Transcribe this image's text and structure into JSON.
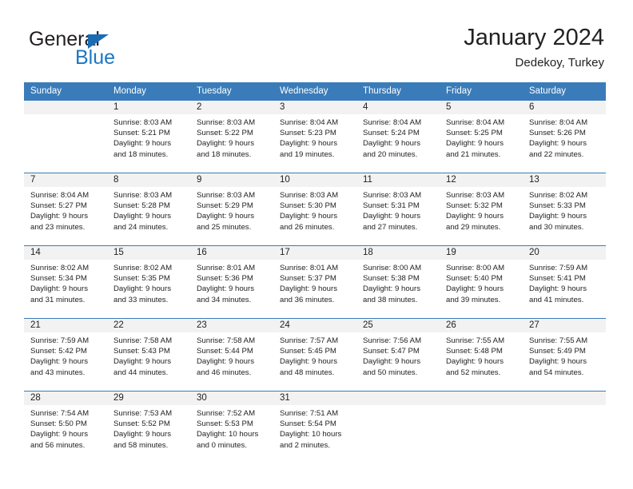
{
  "brand": {
    "name_part1": "General",
    "name_part2": "Blue",
    "triangle_color": "#1c6cb5",
    "blue_color": "#1c76c5"
  },
  "header": {
    "title": "January 2024",
    "subtitle": "Dedekoy, Turkey"
  },
  "theme": {
    "header_blue": "#3a7cb9",
    "daynum_band": "#f2f2f2",
    "text": "#222222"
  },
  "weekday_headers": [
    "Sunday",
    "Monday",
    "Tuesday",
    "Wednesday",
    "Thursday",
    "Friday",
    "Saturday"
  ],
  "weeks": [
    [
      {
        "day": "",
        "sunrise": "",
        "sunset": "",
        "daylight1": "",
        "daylight2": ""
      },
      {
        "day": "1",
        "sunrise": "Sunrise: 8:03 AM",
        "sunset": "Sunset: 5:21 PM",
        "daylight1": "Daylight: 9 hours",
        "daylight2": "and 18 minutes."
      },
      {
        "day": "2",
        "sunrise": "Sunrise: 8:03 AM",
        "sunset": "Sunset: 5:22 PM",
        "daylight1": "Daylight: 9 hours",
        "daylight2": "and 18 minutes."
      },
      {
        "day": "3",
        "sunrise": "Sunrise: 8:04 AM",
        "sunset": "Sunset: 5:23 PM",
        "daylight1": "Daylight: 9 hours",
        "daylight2": "and 19 minutes."
      },
      {
        "day": "4",
        "sunrise": "Sunrise: 8:04 AM",
        "sunset": "Sunset: 5:24 PM",
        "daylight1": "Daylight: 9 hours",
        "daylight2": "and 20 minutes."
      },
      {
        "day": "5",
        "sunrise": "Sunrise: 8:04 AM",
        "sunset": "Sunset: 5:25 PM",
        "daylight1": "Daylight: 9 hours",
        "daylight2": "and 21 minutes."
      },
      {
        "day": "6",
        "sunrise": "Sunrise: 8:04 AM",
        "sunset": "Sunset: 5:26 PM",
        "daylight1": "Daylight: 9 hours",
        "daylight2": "and 22 minutes."
      }
    ],
    [
      {
        "day": "7",
        "sunrise": "Sunrise: 8:04 AM",
        "sunset": "Sunset: 5:27 PM",
        "daylight1": "Daylight: 9 hours",
        "daylight2": "and 23 minutes."
      },
      {
        "day": "8",
        "sunrise": "Sunrise: 8:03 AM",
        "sunset": "Sunset: 5:28 PM",
        "daylight1": "Daylight: 9 hours",
        "daylight2": "and 24 minutes."
      },
      {
        "day": "9",
        "sunrise": "Sunrise: 8:03 AM",
        "sunset": "Sunset: 5:29 PM",
        "daylight1": "Daylight: 9 hours",
        "daylight2": "and 25 minutes."
      },
      {
        "day": "10",
        "sunrise": "Sunrise: 8:03 AM",
        "sunset": "Sunset: 5:30 PM",
        "daylight1": "Daylight: 9 hours",
        "daylight2": "and 26 minutes."
      },
      {
        "day": "11",
        "sunrise": "Sunrise: 8:03 AM",
        "sunset": "Sunset: 5:31 PM",
        "daylight1": "Daylight: 9 hours",
        "daylight2": "and 27 minutes."
      },
      {
        "day": "12",
        "sunrise": "Sunrise: 8:03 AM",
        "sunset": "Sunset: 5:32 PM",
        "daylight1": "Daylight: 9 hours",
        "daylight2": "and 29 minutes."
      },
      {
        "day": "13",
        "sunrise": "Sunrise: 8:02 AM",
        "sunset": "Sunset: 5:33 PM",
        "daylight1": "Daylight: 9 hours",
        "daylight2": "and 30 minutes."
      }
    ],
    [
      {
        "day": "14",
        "sunrise": "Sunrise: 8:02 AM",
        "sunset": "Sunset: 5:34 PM",
        "daylight1": "Daylight: 9 hours",
        "daylight2": "and 31 minutes."
      },
      {
        "day": "15",
        "sunrise": "Sunrise: 8:02 AM",
        "sunset": "Sunset: 5:35 PM",
        "daylight1": "Daylight: 9 hours",
        "daylight2": "and 33 minutes."
      },
      {
        "day": "16",
        "sunrise": "Sunrise: 8:01 AM",
        "sunset": "Sunset: 5:36 PM",
        "daylight1": "Daylight: 9 hours",
        "daylight2": "and 34 minutes."
      },
      {
        "day": "17",
        "sunrise": "Sunrise: 8:01 AM",
        "sunset": "Sunset: 5:37 PM",
        "daylight1": "Daylight: 9 hours",
        "daylight2": "and 36 minutes."
      },
      {
        "day": "18",
        "sunrise": "Sunrise: 8:00 AM",
        "sunset": "Sunset: 5:38 PM",
        "daylight1": "Daylight: 9 hours",
        "daylight2": "and 38 minutes."
      },
      {
        "day": "19",
        "sunrise": "Sunrise: 8:00 AM",
        "sunset": "Sunset: 5:40 PM",
        "daylight1": "Daylight: 9 hours",
        "daylight2": "and 39 minutes."
      },
      {
        "day": "20",
        "sunrise": "Sunrise: 7:59 AM",
        "sunset": "Sunset: 5:41 PM",
        "daylight1": "Daylight: 9 hours",
        "daylight2": "and 41 minutes."
      }
    ],
    [
      {
        "day": "21",
        "sunrise": "Sunrise: 7:59 AM",
        "sunset": "Sunset: 5:42 PM",
        "daylight1": "Daylight: 9 hours",
        "daylight2": "and 43 minutes."
      },
      {
        "day": "22",
        "sunrise": "Sunrise: 7:58 AM",
        "sunset": "Sunset: 5:43 PM",
        "daylight1": "Daylight: 9 hours",
        "daylight2": "and 44 minutes."
      },
      {
        "day": "23",
        "sunrise": "Sunrise: 7:58 AM",
        "sunset": "Sunset: 5:44 PM",
        "daylight1": "Daylight: 9 hours",
        "daylight2": "and 46 minutes."
      },
      {
        "day": "24",
        "sunrise": "Sunrise: 7:57 AM",
        "sunset": "Sunset: 5:45 PM",
        "daylight1": "Daylight: 9 hours",
        "daylight2": "and 48 minutes."
      },
      {
        "day": "25",
        "sunrise": "Sunrise: 7:56 AM",
        "sunset": "Sunset: 5:47 PM",
        "daylight1": "Daylight: 9 hours",
        "daylight2": "and 50 minutes."
      },
      {
        "day": "26",
        "sunrise": "Sunrise: 7:55 AM",
        "sunset": "Sunset: 5:48 PM",
        "daylight1": "Daylight: 9 hours",
        "daylight2": "and 52 minutes."
      },
      {
        "day": "27",
        "sunrise": "Sunrise: 7:55 AM",
        "sunset": "Sunset: 5:49 PM",
        "daylight1": "Daylight: 9 hours",
        "daylight2": "and 54 minutes."
      }
    ],
    [
      {
        "day": "28",
        "sunrise": "Sunrise: 7:54 AM",
        "sunset": "Sunset: 5:50 PM",
        "daylight1": "Daylight: 9 hours",
        "daylight2": "and 56 minutes."
      },
      {
        "day": "29",
        "sunrise": "Sunrise: 7:53 AM",
        "sunset": "Sunset: 5:52 PM",
        "daylight1": "Daylight: 9 hours",
        "daylight2": "and 58 minutes."
      },
      {
        "day": "30",
        "sunrise": "Sunrise: 7:52 AM",
        "sunset": "Sunset: 5:53 PM",
        "daylight1": "Daylight: 10 hours",
        "daylight2": "and 0 minutes."
      },
      {
        "day": "31",
        "sunrise": "Sunrise: 7:51 AM",
        "sunset": "Sunset: 5:54 PM",
        "daylight1": "Daylight: 10 hours",
        "daylight2": "and 2 minutes."
      },
      {
        "day": "",
        "sunrise": "",
        "sunset": "",
        "daylight1": "",
        "daylight2": ""
      },
      {
        "day": "",
        "sunrise": "",
        "sunset": "",
        "daylight1": "",
        "daylight2": ""
      },
      {
        "day": "",
        "sunrise": "",
        "sunset": "",
        "daylight1": "",
        "daylight2": ""
      }
    ]
  ]
}
